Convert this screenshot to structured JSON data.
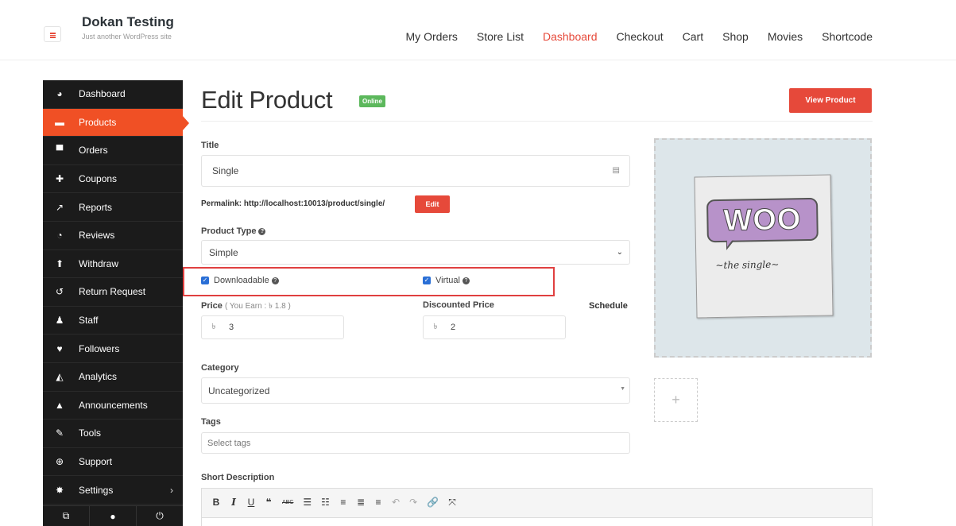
{
  "header": {
    "site_title": "Dokan Testing",
    "site_tagline": "Just another WordPress site",
    "nav": [
      {
        "label": "My Orders"
      },
      {
        "label": "Store List"
      },
      {
        "label": "Dashboard",
        "active": true
      },
      {
        "label": "Checkout"
      },
      {
        "label": "Cart"
      },
      {
        "label": "Shop"
      },
      {
        "label": "Movies"
      },
      {
        "label": "Shortcode"
      }
    ]
  },
  "sidebar": {
    "items": [
      {
        "label": "Dashboard",
        "icon": "dashboard-icon"
      },
      {
        "label": "Products",
        "icon": "briefcase-icon",
        "active": true
      },
      {
        "label": "Orders",
        "icon": "cart-icon"
      },
      {
        "label": "Coupons",
        "icon": "gift-icon"
      },
      {
        "label": "Reports",
        "icon": "chart-icon"
      },
      {
        "label": "Reviews",
        "icon": "comments-icon"
      },
      {
        "label": "Withdraw",
        "icon": "upload-icon"
      },
      {
        "label": "Return Request",
        "icon": "undo-icon"
      },
      {
        "label": "Staff",
        "icon": "users-icon"
      },
      {
        "label": "Followers",
        "icon": "heart-icon"
      },
      {
        "label": "Analytics",
        "icon": "area-chart-icon"
      },
      {
        "label": "Announcements",
        "icon": "bell-icon"
      },
      {
        "label": "Tools",
        "icon": "wrench-icon"
      },
      {
        "label": "Support",
        "icon": "lifebuoy-icon"
      },
      {
        "label": "Settings",
        "icon": "gear-icon"
      }
    ],
    "bottom_icons": [
      "external-link-icon",
      "user-icon",
      "power-icon"
    ]
  },
  "main": {
    "page_title": "Edit Product",
    "status_badge": "Online",
    "view_button": "View Product",
    "title_label": "Title",
    "title_value": "Single",
    "permalink_text": "Permalink: http://localhost:10013/product/single/",
    "permalink_edit": "Edit",
    "product_type_label": "Product Type",
    "product_type_value": "Simple",
    "downloadable_label": "Downloadable",
    "virtual_label": "Virtual",
    "price_label": "Price",
    "price_earn": "( You Earn : ৳ 1.8 )",
    "price_currency": "৳",
    "price_value": "3",
    "discount_label": "Discounted Price",
    "discount_value": "2",
    "schedule_label": "Schedule",
    "category_label": "Category",
    "category_value": "Uncategorized",
    "tags_label": "Tags",
    "tags_placeholder": "Select tags",
    "short_desc_label": "Short Description"
  },
  "image": {
    "woo_text": "WOO",
    "caption": "~the single~",
    "add_symbol": "+"
  },
  "editor": {
    "toolbar": [
      "B",
      "I",
      "U",
      "❝",
      "ABC",
      "☰",
      "☷",
      "≡",
      "≣",
      "≡",
      "↶",
      "↷",
      "🔗",
      "⤧"
    ]
  },
  "colors": {
    "accent": "#e6493a",
    "sidebar_bg": "#1b1b1b",
    "sidebar_active": "#f05025",
    "online_badge": "#5cb85c",
    "highlight_border": "#e04040"
  }
}
